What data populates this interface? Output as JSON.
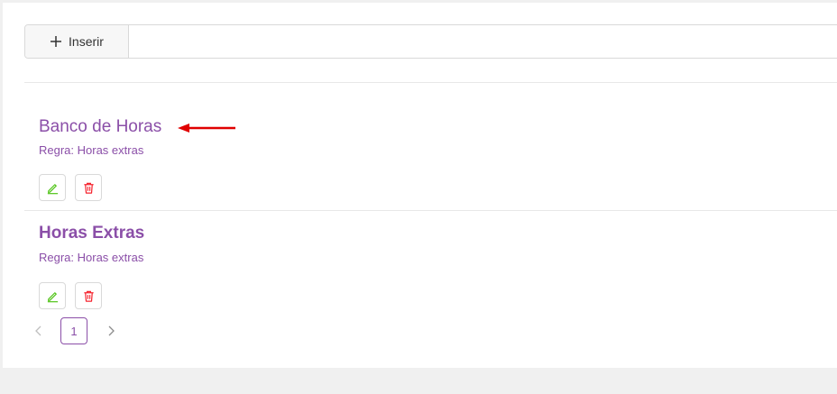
{
  "toolbar": {
    "insert_label": "Inserir"
  },
  "items": [
    {
      "title": "Banco de Horas",
      "rule": "Regra: Horas extras"
    },
    {
      "title": "Horas Extras",
      "rule": "Regra: Horas extras"
    }
  ],
  "pagination": {
    "current_page": "1"
  },
  "icons": {
    "insert": "plus-icon",
    "edit": "pencil-icon",
    "delete": "trash-icon",
    "prev": "chevron-left-icon",
    "next": "chevron-right-icon",
    "annotation": "arrow-left-icon"
  },
  "colors": {
    "accent": "#8b4fa8",
    "edit": "#52c41a",
    "delete": "#f5222d",
    "annotation_arrow": "#e00000"
  }
}
